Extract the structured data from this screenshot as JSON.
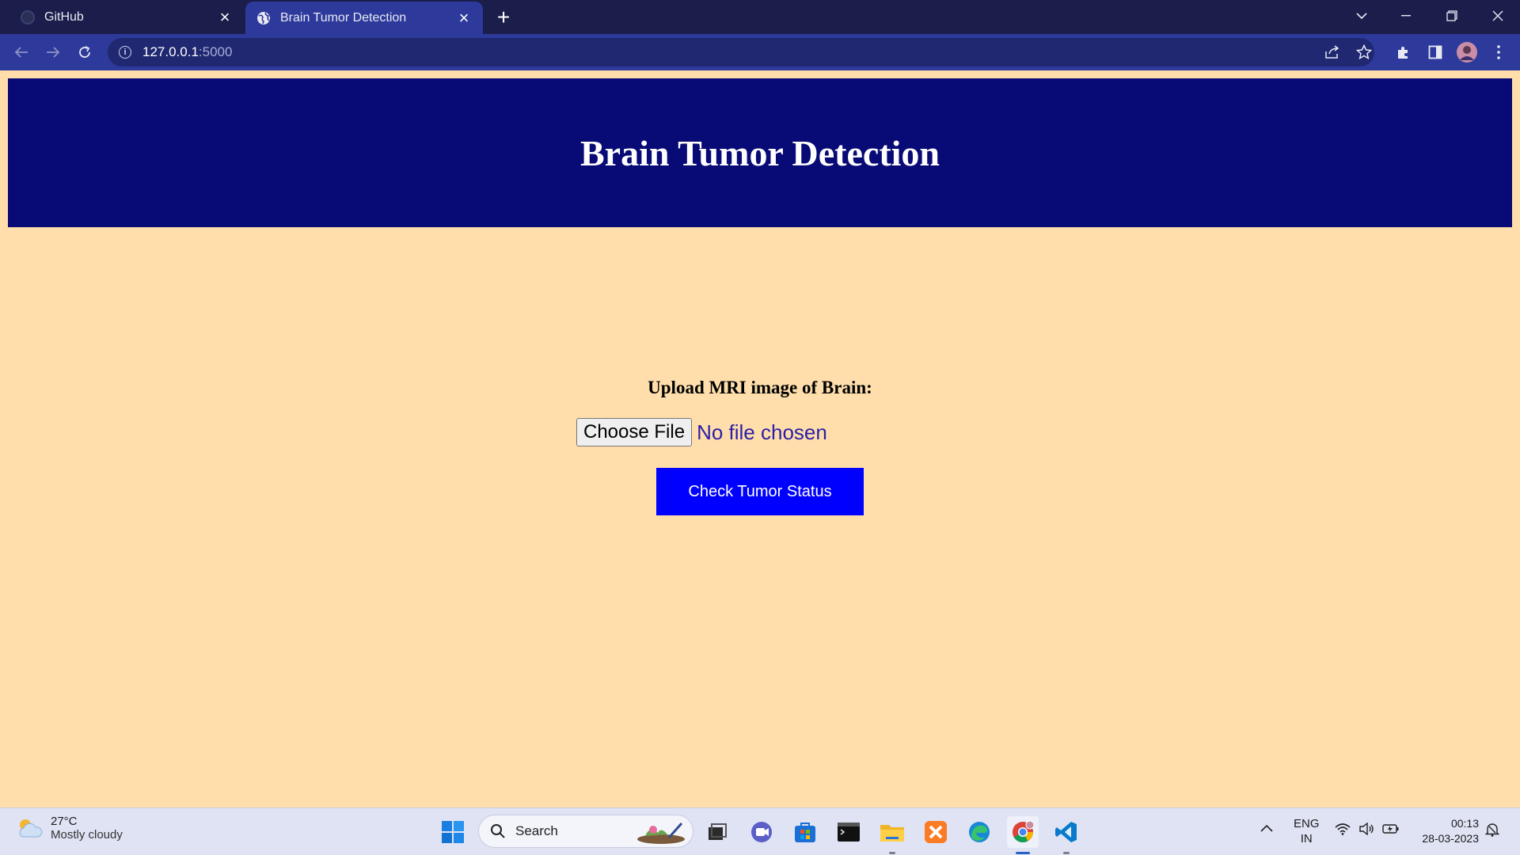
{
  "browser": {
    "tabs": [
      {
        "title": "GitHub",
        "active": false
      },
      {
        "title": "Brain Tumor Detection",
        "active": true
      }
    ],
    "url_host": "127.0.0.1",
    "url_port": ":5000"
  },
  "page": {
    "title": "Brain Tumor Detection",
    "upload_label": "Upload MRI image of Brain:",
    "choose_file_label": "Choose File",
    "no_file_text": "No file chosen",
    "submit_label": "Check Tumor Status",
    "colors": {
      "background": "#ffdeab",
      "header": "#080a75",
      "button": "#0000ff"
    }
  },
  "taskbar": {
    "weather_temp": "27°C",
    "weather_condition": "Mostly cloudy",
    "search_placeholder": "Search",
    "language_line1": "ENG",
    "language_line2": "IN",
    "time": "00:13",
    "date": "28-03-2023",
    "apps": [
      "start-icon",
      "search",
      "task-view-icon",
      "teams-chat-icon",
      "microsoft-store-icon",
      "terminal-icon",
      "file-explorer-icon",
      "xampp-icon",
      "edge-icon",
      "chrome-icon",
      "vscode-icon"
    ]
  }
}
